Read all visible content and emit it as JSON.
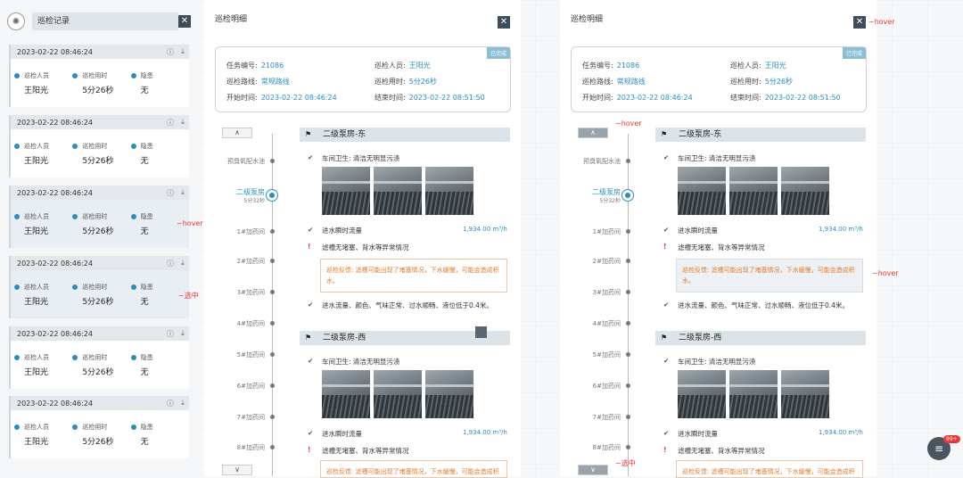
{
  "list": {
    "title": "巡检记录",
    "close": "✕",
    "logo": "✺",
    "cards": [
      {
        "datetime": "2023-02-22 08:46:24",
        "l1": "巡检人员",
        "v1": "王阳光",
        "l2": "巡检用时",
        "v2": "5分26秒",
        "l3": "隐患",
        "v3": "无"
      },
      {
        "datetime": "2023-02-22 08:46:24",
        "l1": "巡检人员",
        "v1": "王阳光",
        "l2": "巡检用时",
        "v2": "5分26秒",
        "l3": "隐患",
        "v3": "无"
      },
      {
        "datetime": "2023-02-22 08:46:24",
        "l1": "巡检人员",
        "v1": "王阳光",
        "l2": "巡检用时",
        "v2": "5分26秒",
        "l3": "隐患",
        "v3": "无"
      },
      {
        "datetime": "2023-02-22 08:46:24",
        "l1": "巡检人员",
        "v1": "王阳光",
        "l2": "巡检用时",
        "v2": "5分26秒",
        "l3": "隐患",
        "v3": "无"
      },
      {
        "datetime": "2023-02-22 08:46:24",
        "l1": "巡检人员",
        "v1": "王阳光",
        "l2": "巡检用时",
        "v2": "5分26秒",
        "l3": "隐患",
        "v3": "无"
      },
      {
        "datetime": "2023-02-22 08:46:24",
        "l1": "巡检人员",
        "v1": "王阳光",
        "l2": "巡检用时",
        "v2": "5分26秒",
        "l3": "隐患",
        "v3": "无"
      }
    ],
    "hover_note": "~hover",
    "select_note": "~选中"
  },
  "detail": {
    "title": "巡检明细",
    "close": "✕",
    "badge": "已完成",
    "task_no_label": "任务编号:",
    "task_no": "21086",
    "route_label": "巡检路线:",
    "route": "常规路线",
    "start_label": "开始时间:",
    "start": "2023-02-22 08:46:24",
    "person_label": "巡检人员:",
    "person": "王阳光",
    "duration_label": "巡检用时:",
    "duration": "5分26秒",
    "end_label": "结束时间:",
    "end": "2023-02-22 08:51:50",
    "timeline": [
      "预臭氧配水池",
      "二级泵房",
      "1#加药间",
      "2#加药间",
      "3#加药间",
      "4#加药间",
      "5#加药间",
      "6#加药间",
      "7#加药间",
      "8#加药间"
    ],
    "active_sub": "5分32秒",
    "up": "∧",
    "down": "∨",
    "sec1": "二级泵房-东",
    "sec2": "二级泵房-西",
    "item_hygiene": "车间卫生: 清洁无明显污渍",
    "item_flow": "进水瞬时流量",
    "flow_val": "1,934.00 m³/h",
    "item_issue": "滤槽无堵塞、背水等异常情况",
    "warn_text": "巡检反馈: 滤槽可能出现了堵塞情况，下水缓慢，可能会造成积水。",
    "item_normal": "进水流量、颜色、气味正常、过水顺畅、液位低于0.4米。",
    "flag": "⚑",
    "check": "✔",
    "excl": "!"
  },
  "notes": {
    "hover": "~hover",
    "select": "~选中",
    "hover2": "~hover",
    "hover3": "~hover"
  },
  "widget": {
    "badge": "99+",
    "icon": "≡"
  }
}
